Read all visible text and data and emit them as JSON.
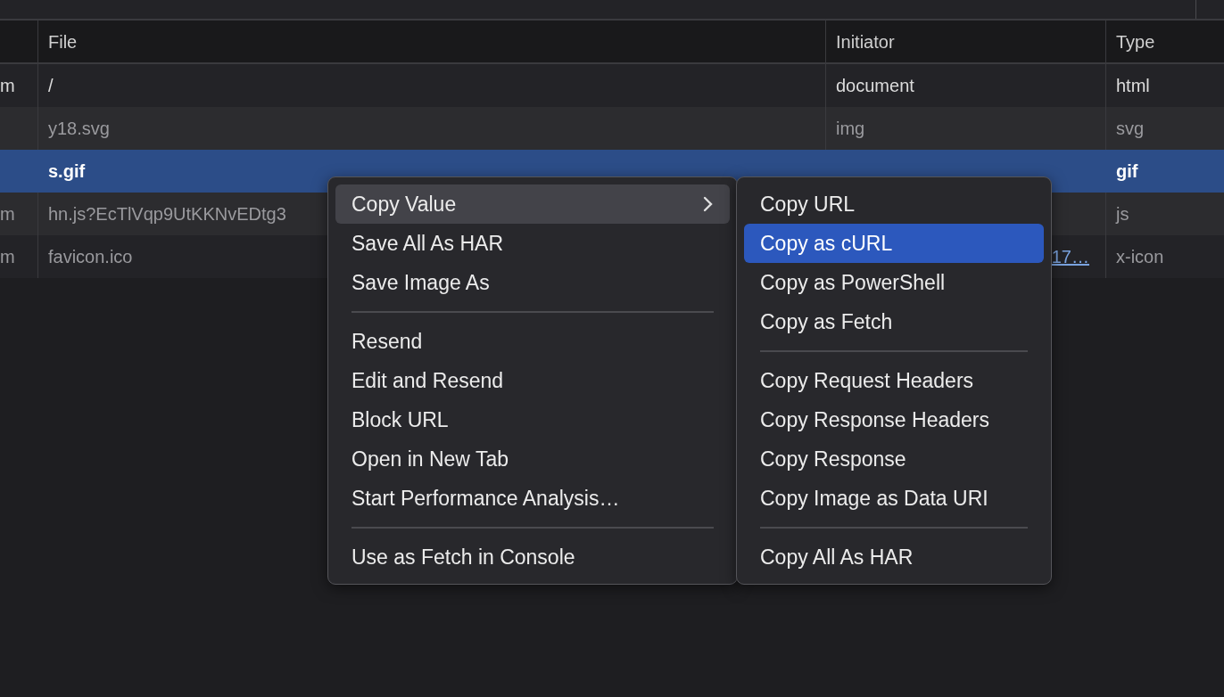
{
  "table": {
    "columns": [
      {
        "label": "File"
      },
      {
        "label": "Initiator"
      },
      {
        "label": "Type"
      }
    ],
    "rows": [
      {
        "column_1": "m",
        "file": "/",
        "initiator": "document",
        "type": "html",
        "dimmed": false,
        "selected": false
      },
      {
        "file": "y18.svg",
        "initiator": "img",
        "type": "svg",
        "dimmed": true,
        "selected": false
      },
      {
        "file": "s.gif",
        "type": "gif",
        "dimmed": false,
        "selected": true
      },
      {
        "column_1": "m",
        "file": "hn.js?EcTlVqp9UtKKNvEDtg3",
        "type": "js",
        "dimmed": true,
        "selected": false
      },
      {
        "column_1": "m",
        "file": "favicon.ico",
        "initiator": "17…",
        "initiator_link": true,
        "type": "x-icon",
        "dimmed": true,
        "selected": false
      }
    ]
  },
  "context_menu": {
    "items": [
      {
        "kind": "item",
        "label": "Copy Value",
        "submenu": true,
        "selected": true
      },
      {
        "kind": "item",
        "label": "Save All As HAR",
        "submenu": false,
        "selected": false
      },
      {
        "kind": "item",
        "label": "Save Image As",
        "submenu": false,
        "selected": false
      },
      {
        "kind": "separator"
      },
      {
        "kind": "item",
        "label": "Resend",
        "submenu": false,
        "selected": false
      },
      {
        "kind": "item",
        "label": "Edit and Resend",
        "submenu": false,
        "selected": false
      },
      {
        "kind": "item",
        "label": "Block URL",
        "submenu": false,
        "selected": false
      },
      {
        "kind": "item",
        "label": "Open in New Tab",
        "submenu": false,
        "selected": false
      },
      {
        "kind": "item",
        "label": "Start Performance Analysis…",
        "submenu": false,
        "selected": false
      },
      {
        "kind": "separator"
      },
      {
        "kind": "item",
        "label": "Use as Fetch in Console",
        "submenu": false,
        "selected": false
      }
    ]
  },
  "submenu": {
    "items": [
      {
        "kind": "item",
        "label": "Copy URL",
        "selected": false
      },
      {
        "kind": "item",
        "label": "Copy as cURL",
        "selected": true
      },
      {
        "kind": "item",
        "label": "Copy as PowerShell",
        "selected": false
      },
      {
        "kind": "item",
        "label": "Copy as Fetch",
        "selected": false
      },
      {
        "kind": "separator"
      },
      {
        "kind": "item",
        "label": "Copy Request Headers",
        "selected": false
      },
      {
        "kind": "item",
        "label": "Copy Response Headers",
        "selected": false
      },
      {
        "kind": "item",
        "label": "Copy Response",
        "selected": false
      },
      {
        "kind": "item",
        "label": "Copy Image as Data URI",
        "selected": false
      },
      {
        "kind": "separator"
      },
      {
        "kind": "item",
        "label": "Copy All As HAR",
        "selected": false
      }
    ]
  }
}
